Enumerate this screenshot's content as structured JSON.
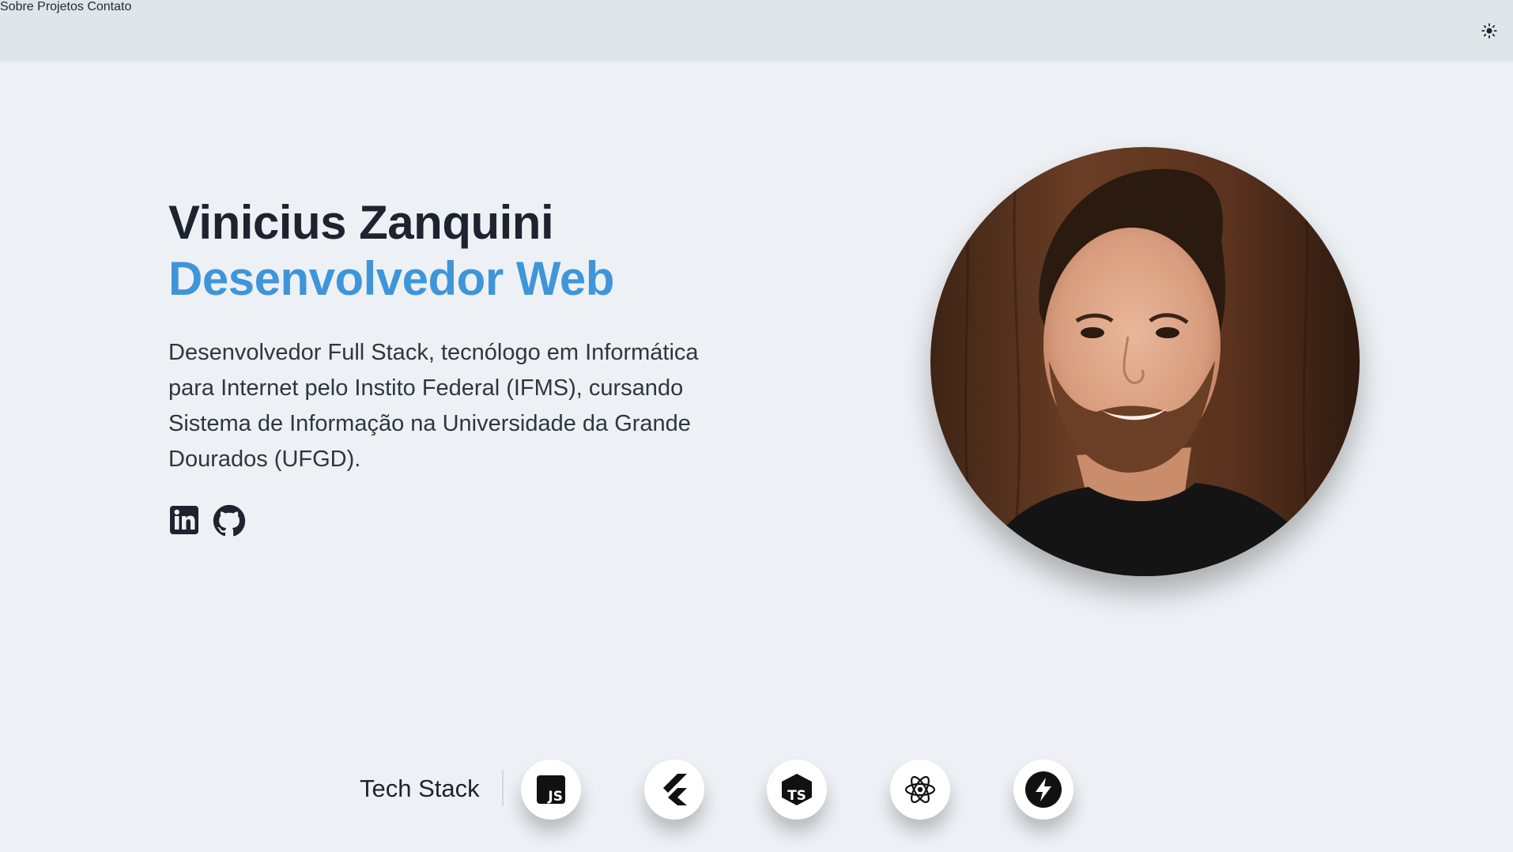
{
  "nav": {
    "items": [
      {
        "label": "Sobre"
      },
      {
        "label": "Projetos"
      },
      {
        "label": "Contato"
      }
    ],
    "theme_icon": "sun-icon"
  },
  "hero": {
    "name": "Vinicius Zanquini",
    "role": "Desenvolvedor Web",
    "bio": "Desenvolvedor Full Stack, tecnólogo em Informática para Internet pelo Instito Federal (IFMS), cursando Sistema de Informação na Universidade da Grande Dourados (UFGD).",
    "socials": [
      {
        "icon": "linkedin-icon"
      },
      {
        "icon": "github-icon"
      }
    ]
  },
  "tech_stack": {
    "label": "Tech Stack",
    "items": [
      {
        "icon": "javascript-icon"
      },
      {
        "icon": "flutter-icon"
      },
      {
        "icon": "typescript-icon"
      },
      {
        "icon": "react-icon"
      },
      {
        "icon": "supabase-icon"
      }
    ]
  },
  "colors": {
    "background": "#edf1f5",
    "header": "#e0e5ea",
    "accent": "#3f95d9",
    "text": "#1d2430"
  }
}
